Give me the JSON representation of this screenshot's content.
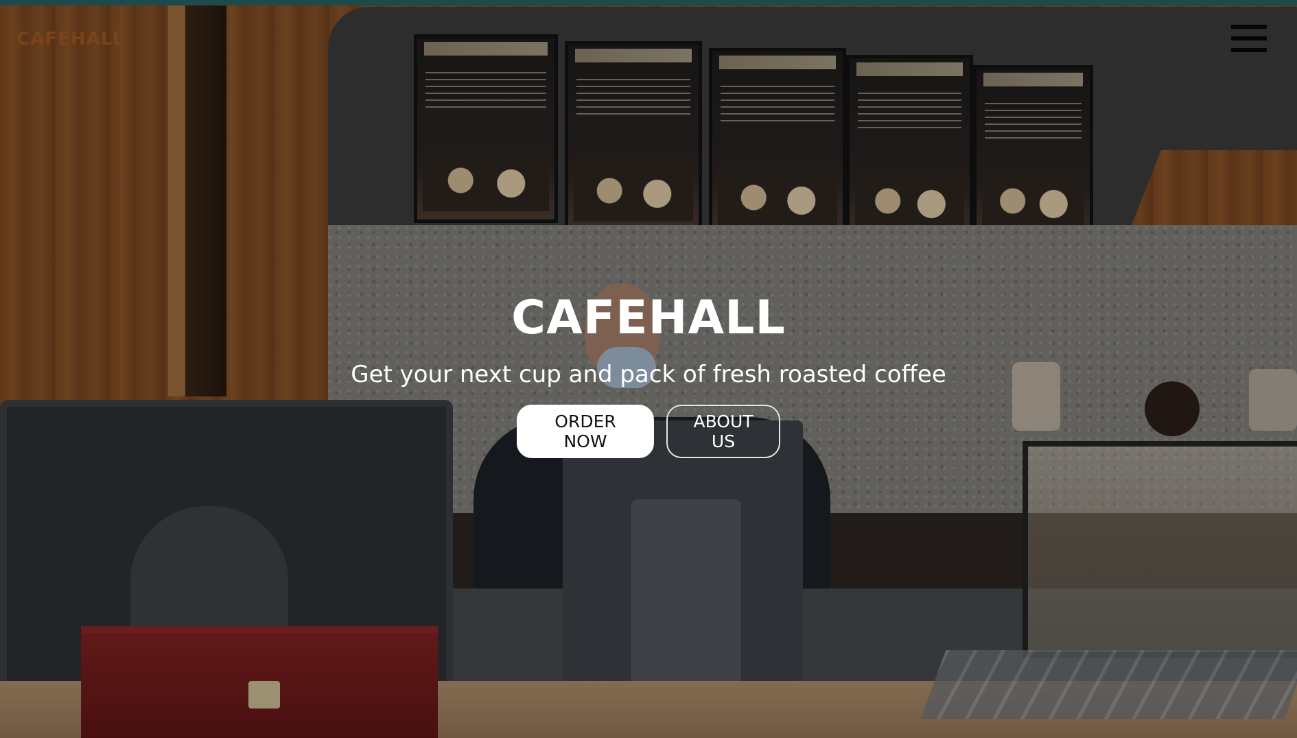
{
  "header": {
    "logo_text": "CAFEHALL",
    "menu_icon": "hamburger-menu-icon"
  },
  "hero": {
    "title": "CAFEHALL",
    "subtitle": "Get your next cup and pack of fresh roasted coffee",
    "primary_button": "ORDER NOW",
    "secondary_button": "ABOUT US"
  },
  "colors": {
    "top_bar": "#1f4a4a",
    "logo": "#7a4318",
    "hero_text": "#ffffff",
    "primary_button_bg": "#ffffff",
    "primary_button_text": "#111111"
  }
}
